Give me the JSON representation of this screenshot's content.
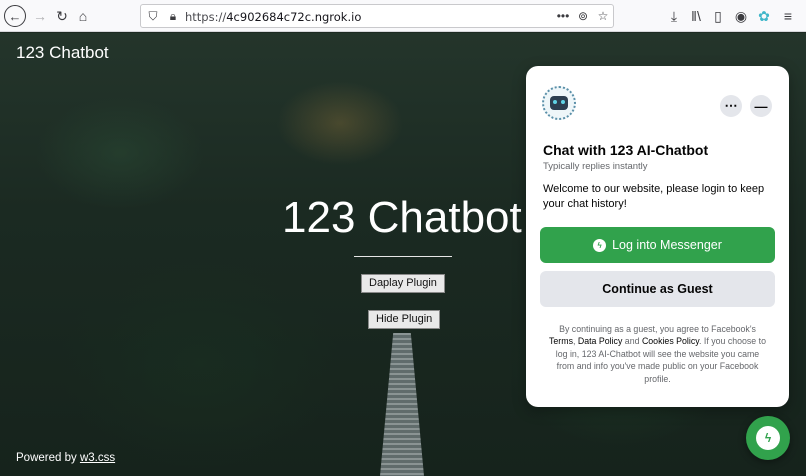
{
  "browser": {
    "url_prefix": "https://",
    "url_host": "4c902684c72c.ngrok.io",
    "icons": [
      "back-icon",
      "forward-icon",
      "reload-icon",
      "home-icon",
      "shield-icon",
      "lock-icon",
      "more-icon",
      "pocket-icon",
      "bookmark-star-icon",
      "download-icon",
      "library-icon",
      "sidebar-icon",
      "account-icon",
      "extension-icon",
      "menu-icon"
    ]
  },
  "site": {
    "title": "123 Chatbot",
    "hero_title": "123 Chatbot",
    "display_button": "Daplay Plugin",
    "hide_button": "Hide Plugin",
    "powered_prefix": "Powered by ",
    "powered_link": "w3.css"
  },
  "widget": {
    "title": "Chat with 123 AI-Chatbot",
    "subtitle": "Typically replies instantly",
    "welcome": "Welcome to our website, please login to keep your chat history!",
    "login_button": "Log into Messenger",
    "guest_button": "Continue as Guest",
    "terms_1": "By continuing as a guest, you agree to Facebook's ",
    "terms_link1": "Terms",
    "terms_2": ", ",
    "terms_link2": "Data Policy",
    "terms_3": " and ",
    "terms_link3": "Cookies Policy",
    "terms_4": ". If you choose to log in, 123 AI-Chatbot will see the website you came from and info you've made public on your Facebook profile."
  },
  "colors": {
    "messenger_green": "#31a24c",
    "widget_bg": "#ffffff",
    "button_gray": "#e4e6eb"
  }
}
